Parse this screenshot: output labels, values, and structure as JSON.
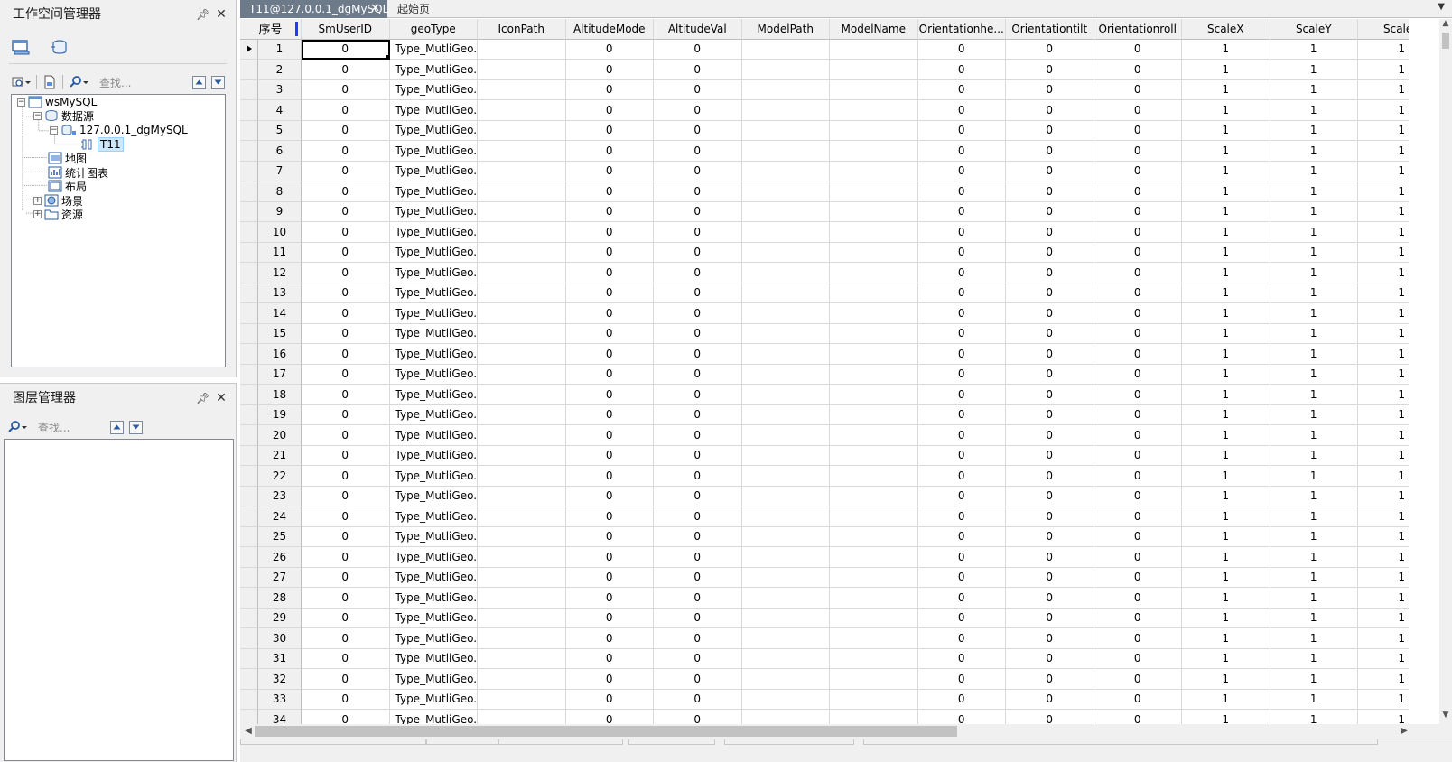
{
  "tabs": {
    "active_label": "T11@127.0.0.1_dgMySQL",
    "inactive_label": "起始页"
  },
  "workspace_panel": {
    "title": "工作空间管理器",
    "find_placeholder": "查找...",
    "tree": {
      "root": "wsMySQL",
      "datasources": "数据源",
      "datasource": "127.0.0.1_dgMySQL",
      "dataset": "T11",
      "maps": "地图",
      "charts": "统计图表",
      "layouts": "布局",
      "scenes": "场景",
      "resources": "资源"
    }
  },
  "layer_panel": {
    "title": "图层管理器",
    "find_placeholder": "查找..."
  },
  "table": {
    "row_header_label": "序号",
    "columns": [
      "SmUserID",
      "geoType",
      "IconPath",
      "AltitudeMode",
      "AltitudeVal",
      "ModelPath",
      "ModelName",
      "Orientationhe...",
      "Orientationtilt",
      "Orientationroll",
      "ScaleX",
      "ScaleY",
      "ScaleZ"
    ],
    "row_values": [
      "0",
      "Type_MutliGeo...",
      "",
      "0",
      "0",
      "",
      "",
      "0",
      "0",
      "0",
      "1",
      "1",
      "1"
    ],
    "row_numbers": [
      "1",
      "2",
      "3",
      "4",
      "5",
      "6",
      "7",
      "8",
      "9",
      "10",
      "11",
      "12",
      "13",
      "14",
      "15",
      "16",
      "17",
      "18",
      "19",
      "20",
      "21",
      "22",
      "23",
      "24",
      "25",
      "26",
      "27",
      "28",
      "29",
      "30",
      "31",
      "32",
      "33",
      "34"
    ],
    "current_row": 1
  },
  "icons": {
    "pin": "pin-icon",
    "close": "close-icon"
  }
}
